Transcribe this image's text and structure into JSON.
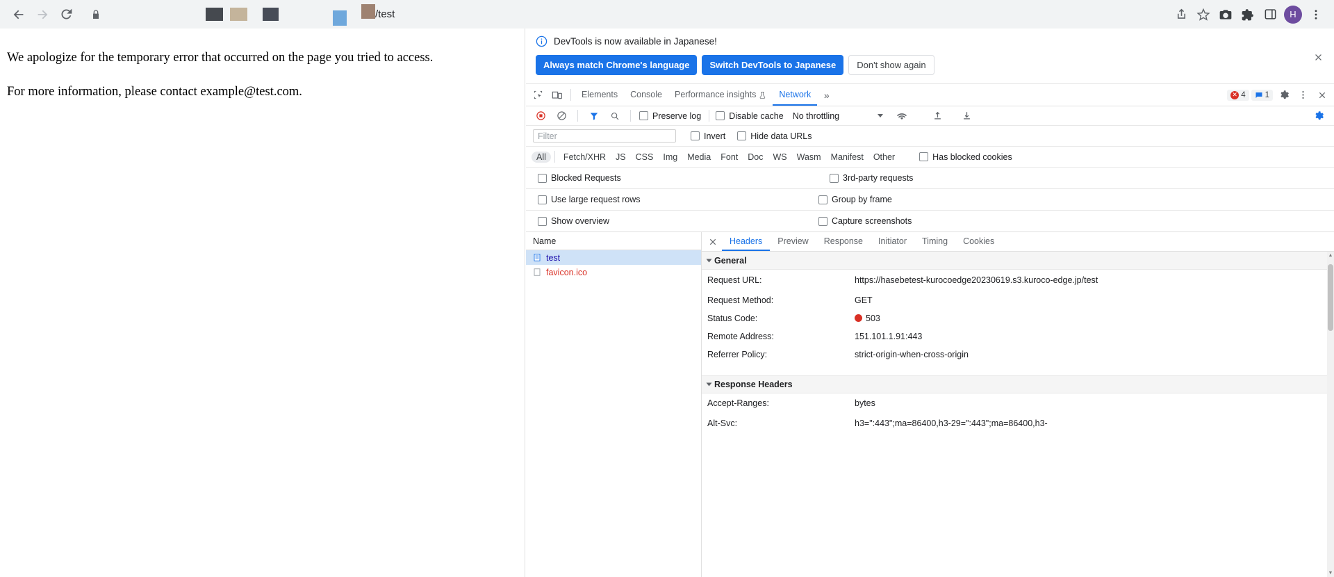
{
  "browser": {
    "back_icon": "back-arrow-icon",
    "forward_icon": "forward-arrow-icon",
    "reload_icon": "reload-icon",
    "lock_icon": "lock-icon",
    "url_suffix": "/test",
    "url_redacted": true,
    "redaction_colors": [
      "#45494f",
      "#c4b49b",
      "#474c57",
      "#6fa8dc",
      "#9e8271"
    ],
    "share_icon": "share-icon",
    "bookmark_icon": "star-icon",
    "screenshot_icon": "camera-icon",
    "extensions_icon": "puzzle-piece-icon",
    "sidepanel_icon": "side-panel-icon",
    "avatar_initial": "H",
    "menu_icon": "three-dot-menu-icon"
  },
  "page": {
    "paragraph1": "We apologize for the temporary error that occurred on the page you tried to access.",
    "paragraph2": "For more information, please contact example@test.com."
  },
  "devtools": {
    "banner": {
      "info_icon": "info-circle-icon",
      "message": "DevTools is now available in Japanese!",
      "primary_1": "Always match Chrome's language",
      "primary_2": "Switch DevTools to Japanese",
      "plain": "Don't show again",
      "close_icon": "close-icon"
    },
    "tabbar": {
      "inspect_icon": "inspect-element-icon",
      "device_icon": "device-toolbar-icon",
      "tabs": [
        {
          "label": "Elements",
          "active": false
        },
        {
          "label": "Console",
          "active": false
        },
        {
          "label": "Performance insights",
          "active": false,
          "beaker_icon": "beaker-icon"
        },
        {
          "label": "Network",
          "active": true
        }
      ],
      "more_tabs": "»",
      "error_count": "4",
      "message_count": "1",
      "settings_icon": "gear-icon",
      "more_icon": "three-dot-menu-icon",
      "close_icon": "close-icon"
    },
    "network_toolbar": {
      "record_icon": "record-stop-icon",
      "clear_icon": "clear-icon",
      "filter_icon": "filter-funnel-icon",
      "search_icon": "search-icon",
      "preserve_log": "Preserve log",
      "disable_cache": "Disable cache",
      "throttle_value": "No throttling",
      "wifi_icon": "network-conditions-icon",
      "import_icon": "import-har-icon",
      "export_icon": "export-har-icon",
      "settings_icon": "gear-icon"
    },
    "filter_row": {
      "placeholder": "Filter",
      "value": "",
      "invert": "Invert",
      "hide_data_urls": "Hide data URLs"
    },
    "type_filters": [
      "All",
      "Fetch/XHR",
      "JS",
      "CSS",
      "Img",
      "Media",
      "Font",
      "Doc",
      "WS",
      "Wasm",
      "Manifest",
      "Other"
    ],
    "active_type": "All",
    "has_blocked_cookies": "Has blocked cookies",
    "blocked_requests": "Blocked Requests",
    "third_party": "3rd-party requests",
    "large_rows": "Use large request rows",
    "group_by_frame": "Group by frame",
    "show_overview": "Show overview",
    "capture_screenshots": "Capture screenshots",
    "request_list": {
      "header": "Name",
      "rows": [
        {
          "name": "test",
          "icon": "document-icon",
          "selected": true,
          "error": false
        },
        {
          "name": "favicon.ico",
          "icon": "document-icon",
          "selected": false,
          "error": true
        }
      ]
    },
    "detail": {
      "close_icon": "close-icon",
      "tabs": [
        {
          "label": "Headers",
          "active": true
        },
        {
          "label": "Preview",
          "active": false
        },
        {
          "label": "Response",
          "active": false
        },
        {
          "label": "Initiator",
          "active": false
        },
        {
          "label": "Timing",
          "active": false
        },
        {
          "label": "Cookies",
          "active": false
        }
      ],
      "general_title": "General",
      "general": [
        {
          "key": "Request URL:",
          "value": "https://hasebetest-kurocoedge20230619.s3.kuroco-edge.jp/test"
        },
        {
          "key": "Request Method:",
          "value": "GET"
        },
        {
          "key": "Status Code:",
          "value": "503",
          "status": true
        },
        {
          "key": "Remote Address:",
          "value": "151.101.1.91:443"
        },
        {
          "key": "Referrer Policy:",
          "value": "strict-origin-when-cross-origin"
        }
      ],
      "response_title": "Response Headers",
      "response": [
        {
          "key": "Accept-Ranges:",
          "value": "bytes"
        },
        {
          "key": "Alt-Svc:",
          "value": "h3=\":443\";ma=86400,h3-29=\":443\";ma=86400,h3-"
        }
      ]
    }
  }
}
